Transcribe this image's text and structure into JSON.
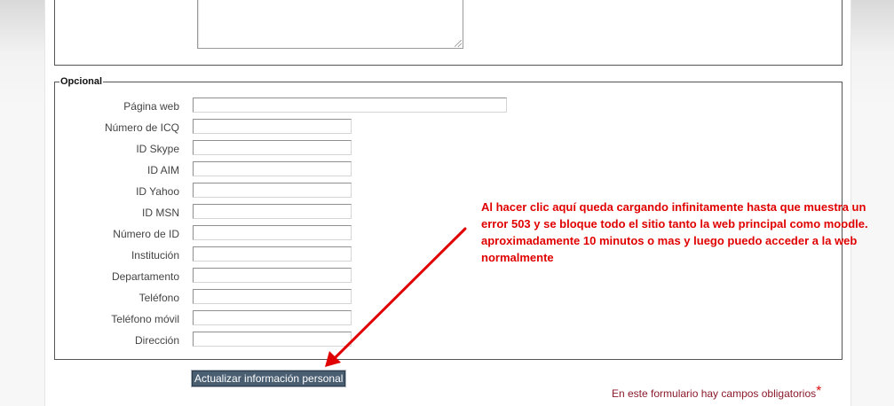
{
  "optional_section": {
    "legend": "Opcional",
    "fields": [
      {
        "label": "Página web",
        "value": ""
      },
      {
        "label": "Número de ICQ",
        "value": ""
      },
      {
        "label": "ID Skype",
        "value": ""
      },
      {
        "label": "ID AIM",
        "value": ""
      },
      {
        "label": "ID Yahoo",
        "value": ""
      },
      {
        "label": "ID MSN",
        "value": ""
      },
      {
        "label": "Número de ID",
        "value": ""
      },
      {
        "label": "Institución",
        "value": ""
      },
      {
        "label": "Departamento",
        "value": ""
      },
      {
        "label": "Teléfono",
        "value": ""
      },
      {
        "label": "Teléfono móvil",
        "value": ""
      },
      {
        "label": "Dirección",
        "value": ""
      }
    ]
  },
  "submit_label": "Actualizar información personal",
  "required_note": "En este formulario hay campos obligatorios",
  "required_marker": "*",
  "annotation": {
    "text": "Al hacer clic aquí queda cargando infinitamente hasta que muestra un error 503 y se bloque todo el sitio tanto la web principal como moodle. aproximadamente 10 minutos o mas y luego puedo acceder a la web normalmente",
    "color": "#e00000"
  },
  "colors": {
    "button_bg": "#4a5e72",
    "required_text": "#8b1a2b"
  }
}
